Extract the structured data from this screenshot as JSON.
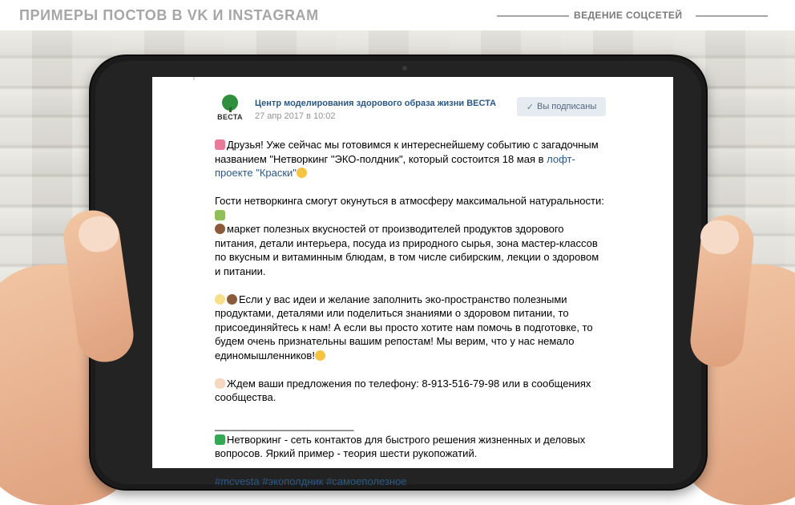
{
  "header": {
    "title": "ПРИМЕРЫ ПОСТОВ В VK И INSTAGRAM",
    "subtitle": "ВЕДЕНИЕ СОЦСЕТЕЙ"
  },
  "post": {
    "logo_text": "ВЕСТА",
    "page_name": "Центр моделирования здорового образа жизни ВЕСТА",
    "date": "27 апр 2017 в 10:02",
    "subscribe_label": "Вы подписаны",
    "p1_text": "Друзья! Уже сейчас мы готовимся к интереснейшему событию с загадочным названием \"Нетворкинг \"ЭКО-полдник\", который состоится 18 мая в ",
    "p1_link": "лофт-проекте \"Краски\"",
    "p2_line1": "Гости нетворкинга смогут окунуться в атмосферу максимальной натуральности:",
    "p2_line2": "маркет полезных вкусностей от производителей продуктов здорового питания, детали интерьера, посуда из природного сырья, зона мастер-классов по вкусным и витаминным блюдам, в том числе сибирским, лекции о здоровом и питании.",
    "p3": "Если у вас идеи и желание заполнить эко-пространство полезными продуктами, деталями или поделиться знаниями о здоровом питании, то присоединяйтесь к нам! А если вы просто хотите нам помочь в подготовке, то будем очень признательны вашим репостам! Мы верим, что у нас немало единомышленников!",
    "p4": "Ждем ваши предложения по телефону: 8-913-516-79-98 или в сообщениях сообщества.",
    "divider": "________________________",
    "p5": "Нетворкинг - сеть контактов для быстрого решения жизненных и деловых вопросов. Яркий пример - теория шести рукопожатий.",
    "hashtags": "#mcvesta #экополдник #самоеполезное"
  },
  "icons": [
    "check-icon",
    "camera-icon",
    "smile-icon",
    "sprout-icon",
    "cookie-icon",
    "plate-icon",
    "hands-icon",
    "woman-icon",
    "building-icon",
    "bulb-icon",
    "wink-icon",
    "clap-icon",
    "sparkle-icon"
  ],
  "colors": {
    "link": "#2a5885",
    "subscribe_bg": "#e5ebf1",
    "header_gray": "#a6a6a6"
  }
}
